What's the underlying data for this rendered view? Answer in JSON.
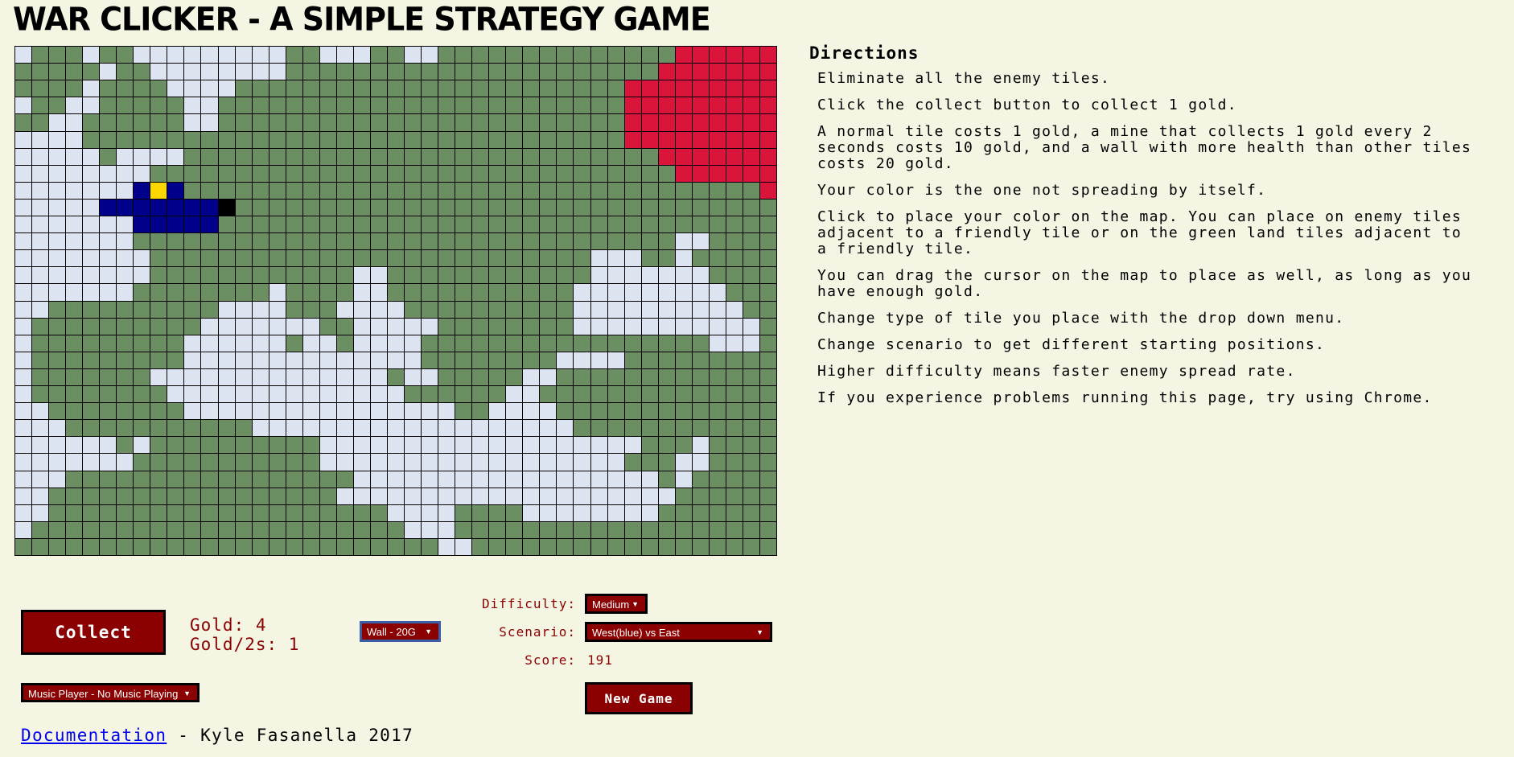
{
  "title": "WAR CLICKER - A SIMPLE STRATEGY GAME",
  "board": {
    "cols": 45,
    "rows": 30,
    "legend": {
      "G": "land",
      "W": "water",
      "E": "enemy",
      "P": "player",
      "M": "mine",
      "K": "wall"
    },
    "colors": {
      "G": "#6b8f62",
      "W": "#dde4f1",
      "E": "#db143c",
      "P": "#00008b",
      "M": "#ffd700",
      "K": "#000000"
    },
    "grid": [
      "WGGGWGGWWWWWWWWWGGWWWGGWWGGGGGGGGGGGGGGEEEEEE",
      "GGGGGWGGWWWWWWWWGGGGGGGGGGGGGGGGGGGGGGEEEEEEE",
      "GGGGWGGGGWWWWGGGGGGGGGGGGGGGGGGGGGGGEEEEEEEEE",
      "WGGWWGGGGGWWGGGGGGGGGGGGGGGGGGGGGGGGEEEEEEEEE",
      "GGWWGGGGGGWWGGGGGGGGGGGGGGGGGGGGGGGGEEEEEEEEE",
      "WWWWGGGGGGGGGGGGGGGGGGGGGGGGGGGGGGGGEEEEEEEEE",
      "WWWWWGWWWWGGGGGGGGGGGGGGGGGGGGGGGGGGGGEEEEEEE",
      "WWWWWWWWGGGGGGGGGGGGGGGGGGGGGGGGGGGGGGGEEEEEE",
      "WWWWWWWPMPGGGGGGGGGGGGGGGGGGGGGGGGGGGGGGGGGGE",
      "WWWWWPPPPPPPKGGGGGGGGGGGGGGGGGGGGGGGGGGGGGGGG",
      "WWWWWWWPPPPPGGGGGGGGGGGGGGGGGGGGGGGGGGGGGGGGG",
      "WWWWWWWGGGGGGGGGGGGGGGGGGGGGGGGGGGGGGGGWWGGGG",
      "WWWWWWWWGGGGGGGGGGGGGGGGGGGGGGGGGGWWWGGWGGGGG",
      "WWWWWWWWGGGGGGGGGGGGWWGGGGGGGGGGGGWWWWWWWGGGG",
      "WWWWWWWGGGGGGGGWGGGGWWGGGGGGGGGGGWWWWWWWWWGGG",
      "WWGGGGGGGGGGWWWWGGGWWWWGGGGGGGGGGWWWWWWWWWWGG",
      "WGGGGGGGGGGWWWWWWWGGWWWWWGGGGGGGGWWWWWWWWWWWG",
      "WGGGGGGGGGWWWWWWGWWGWWWWGGGGGGGGGGGGGGGGGWWWG",
      "WGGGGGGGGGWWWWWWWWWWWWWWGGGGGGGGWWWWGGGGGGGGG",
      "WGGGGGGGWWWWWWWWWWWWWWGWWGGGGGWWGGGGGGGGGGGGG",
      "WGGGGGGGGWWWWWWWWWWWWWWGGGGGGWWGGGGGGGGGGGGGG",
      "WWGGGGGGGGWWWWWWWWWWWWWWWWGGWWWWGGGGGGGGGGGGG",
      "WWWGGGGGGGGGGGWWWWWWWWWWWWWWWWWWWGGGGGGGGGGGG",
      "WWWWWWGWGGGGGGGGGGWWWWWWWWWWWWWWWWWWWGGGWGGGG",
      "WWWWWWWGGGGGGGGGGGWWWWWWWWWWWWWWWWWWGGGWWGGGG",
      "WWWGGGGGGGGGGGGGGGGGWWWWWWWWWWWWWWWWWWGWGGGGG",
      "WWGGGGGGGGGGGGGGGGGWWWWWWWWWWWWWWWWWWWWGGGGGG",
      "WWGGGGGGGGGGGGGGGGGGGGWWWWGGGGWWWWWWWWGGGGGGG",
      "WGGGGGGGGGGGGGGGGGGGGGGWWWGGGGGGGGGGGGGGGGGGG",
      "GGGGGGGGGGGGGGGGGGGGGGGGGWWGGGGGGGGGGGGGGGGGG"
    ]
  },
  "directions": {
    "title": "Directions",
    "items": [
      "Eliminate all the enemy tiles.",
      "Click the collect button to collect 1 gold.",
      "A normal tile costs 1 gold, a mine that collects 1 gold every 2 seconds costs 10 gold, and a wall with more health than other tiles costs 20 gold.",
      "Your color is the one not spreading by itself.",
      "Click to place your color on the map. You can place on enemy tiles adjacent to a friendly tile or on the green land tiles adjacent to a friendly tile.",
      "You can drag the cursor on the map to place as well, as long as you have enough gold.",
      "Change type of tile you place with the drop down menu.",
      "Change scenario to get different starting positions.",
      "Higher difficulty means faster enemy spread rate.",
      "If you experience problems running this page, try using Chrome."
    ]
  },
  "controls": {
    "collect_label": "Collect",
    "gold_text": "Gold: 4",
    "gold_rate_text": "Gold/2s: 1",
    "tile_type": "Wall - 20G",
    "difficulty_label": "Difficulty:",
    "difficulty": "Medium",
    "scenario_label": "Scenario:",
    "scenario": "West(blue) vs East",
    "score_label": "Score:",
    "score": "191",
    "new_game_label": "New Game",
    "music": "Music Player - No Music Playing",
    "arrow": "▼"
  },
  "footer": {
    "link": "Documentation",
    "credit": " - Kyle Fasanella 2017"
  }
}
